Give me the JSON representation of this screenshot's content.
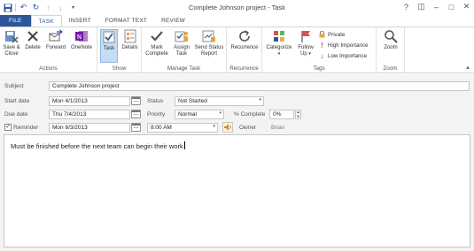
{
  "window": {
    "title": "Complete Johnson project - Task",
    "controls": [
      "?",
      "◫",
      "–",
      "□",
      "✕"
    ]
  },
  "tabs": [
    {
      "label": "FILE"
    },
    {
      "label": "TASK"
    },
    {
      "label": "INSERT"
    },
    {
      "label": "FORMAT TEXT"
    },
    {
      "label": "REVIEW"
    }
  ],
  "ribbon": {
    "actions": {
      "label": "Actions",
      "save_close_l1": "Save &",
      "save_close_l2": "Close",
      "delete": "Delete",
      "forward": "Forward",
      "onenote": "OneNote"
    },
    "show": {
      "label": "Show",
      "task": "Task",
      "details": "Details"
    },
    "manage": {
      "label": "Manage Task",
      "mark_l1": "Mark",
      "mark_l2": "Complete",
      "assign_l1": "Assign",
      "assign_l2": "Task",
      "send_l1": "Send Status",
      "send_l2": "Report"
    },
    "recurrence": {
      "label": "Recurrence",
      "button": "Recurrence"
    },
    "tags": {
      "label": "Tags",
      "categorize": "Categorize",
      "follow_l1": "Follow",
      "follow_l2": "Up",
      "private": "Private",
      "high": "High Importance",
      "low": "Low Importance"
    },
    "zoom": {
      "label": "Zoom",
      "button": "Zoom"
    }
  },
  "form": {
    "subject_label": "Subject",
    "subject_value": "Complete Johnson project",
    "start_label": "Start date",
    "start_value": "Mon 4/1/2013",
    "due_label": "Due date",
    "due_value": "Thu 7/4/2013",
    "status_label": "Status",
    "status_value": "Not Started",
    "priority_label": "Priority",
    "priority_value": "Normal",
    "percent_label": "% Complete",
    "percent_value": "0%",
    "reminder_label": "Reminder",
    "reminder_date": "Mon 6/3/2013",
    "reminder_time": "8:00 AM",
    "owner_label": "Owner",
    "owner_value": "Brian",
    "body_text": "Must be finished before the next team can begin their work"
  },
  "colors": {
    "accent": "#2b579a",
    "selected": "#c5dcf3",
    "form_bg": "#f3f3f3"
  }
}
